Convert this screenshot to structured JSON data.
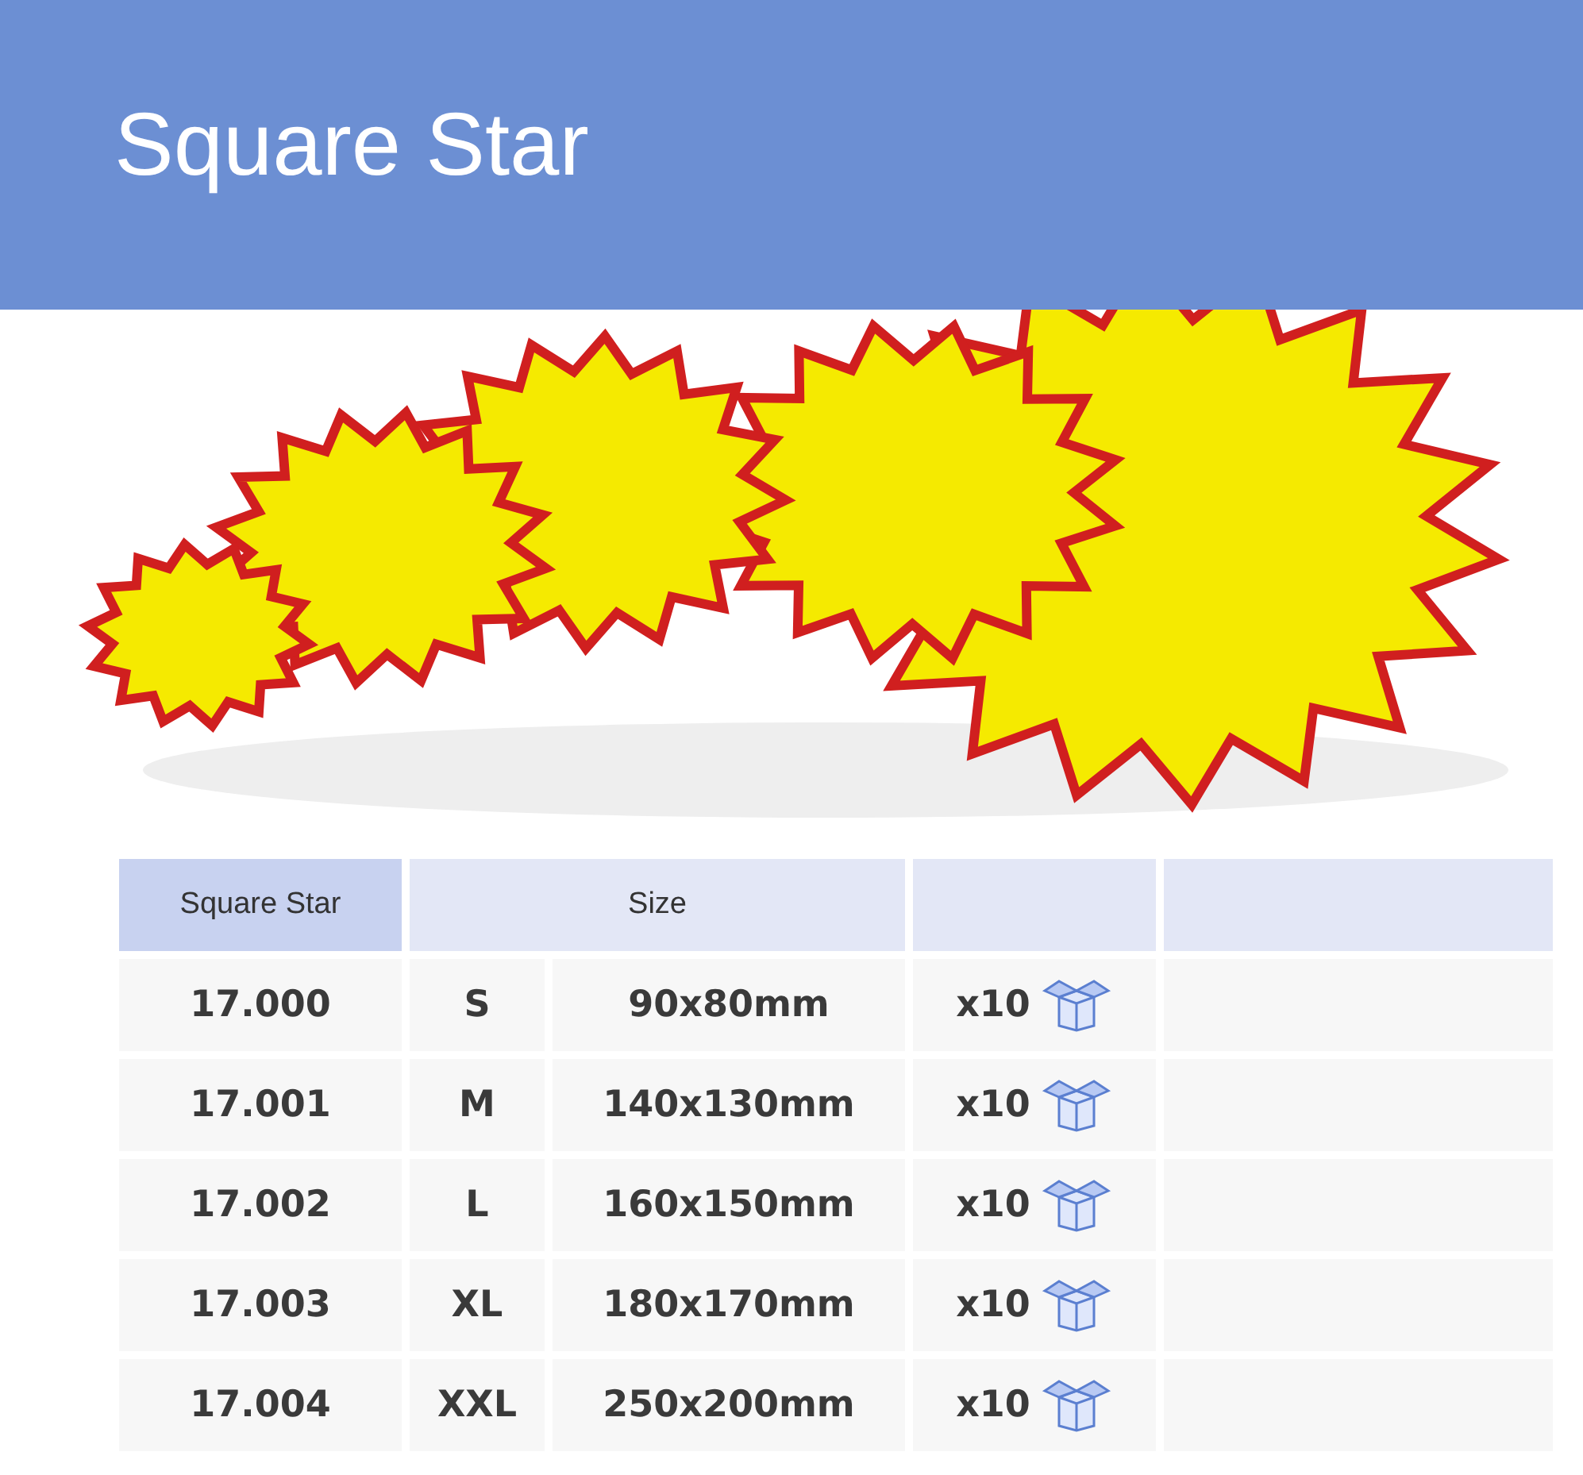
{
  "header": {
    "title": "Square Star"
  },
  "table": {
    "columns": [
      "Square Star",
      "Size"
    ],
    "rows": [
      {
        "code": "17.000",
        "size": "S",
        "dimensions": "90x80mm",
        "quantity": "x10"
      },
      {
        "code": "17.001",
        "size": "M",
        "dimensions": "140x130mm",
        "quantity": "x10"
      },
      {
        "code": "17.002",
        "size": "L",
        "dimensions": "160x150mm",
        "quantity": "x10"
      },
      {
        "code": "17.003",
        "size": "XL",
        "dimensions": "180x170mm",
        "quantity": "x10"
      },
      {
        "code": "17.004",
        "size": "XXL",
        "dimensions": "250x200mm",
        "quantity": "x10"
      }
    ]
  }
}
